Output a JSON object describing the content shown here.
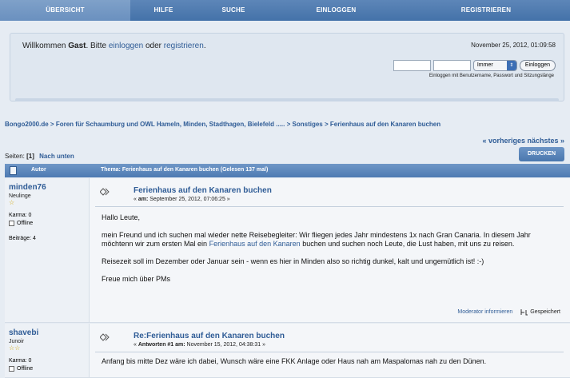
{
  "nav": [
    {
      "label": "Übersicht",
      "active": true
    },
    {
      "label": "Hilfe"
    },
    {
      "label": "Suche"
    },
    {
      "label": "Einloggen"
    },
    {
      "label": "Registrieren"
    }
  ],
  "header": {
    "welcome_prefix": "Willkommen",
    "guest": "Gast",
    "welcome_mid": ". Bitte",
    "login_link": "einloggen",
    "or": "oder",
    "register_link": "registrieren",
    "period": ".",
    "datetime": "November 25, 2012, 01:09:58",
    "session_option": "Immer",
    "login_button": "Einloggen",
    "login_hint": "Einloggen mit Benutzername, Passwort und Sitzungslänge"
  },
  "breadcrumb": {
    "site": "Bongo2000.de",
    "forum": "Foren für Schaumburg und OWL Hameln, Minden, Stadthagen, Bielefeld .....",
    "board": "Sonstiges",
    "topic": "Ferienhaus auf den Kanaren buchen",
    "sep": ">"
  },
  "pagination": {
    "prev_next": "« vorheriges nächstes »",
    "pages_label": "Seiten:",
    "pages_value": "[1]",
    "down_link": "Nach unten",
    "print_button": "Drucken"
  },
  "thread_header": {
    "author": "Autor",
    "topic": "Thema: Ferienhaus auf den Kanaren buchen  (Gelesen 137 mal)"
  },
  "posts": [
    {
      "user": "minden76",
      "rank": "Neulinge",
      "stars": "☆",
      "karma": "Karma: 0",
      "status": "Offline",
      "posts_count": "Beiträge: 4",
      "title": "Ferienhaus auf den Kanaren buchen",
      "meta_prefix": "«",
      "meta_label": "am:",
      "meta_date": "September 25, 2012, 07:06:25 »",
      "greeting": "Hallo Leute,",
      "para1_a": "mein Freund und ich suchen mal wieder nette Reisebegleiter: Wir fliegen jedes Jahr mindestens 1x nach Gran Canaria. In diesem Jahr möchtenn wir zum ersten Mal ein",
      "para1_link": "Ferienhaus auf den Kanaren",
      "para1_b": "buchen und suchen noch Leute, die Lust haben, mit uns zu reisen.",
      "para2": "Reisezeit soll im Dezember oder Januar sein - wenn es hier in Minden also so richtig dunkel, kalt und ungemütlich ist! :-)",
      "para3": "Freue mich über PMs",
      "moderator": "Moderator informieren",
      "saved": "Gespeichert"
    },
    {
      "user": "shavebi",
      "rank": "Junoir",
      "stars": "☆☆",
      "karma": "Karma: 0",
      "status": "Offline",
      "title": "Re:Ferienhaus auf den Kanaren buchen",
      "meta_prefix": "«",
      "meta_label": "Antworten #1 am:",
      "meta_date": "November 15, 2012, 04:38:31 »",
      "text": "Anfang bis mitte Dez wäre ich dabei, Wunsch wäre eine FKK Anlage oder Haus nah am Maspalomas nah zu den Dünen."
    }
  ]
}
